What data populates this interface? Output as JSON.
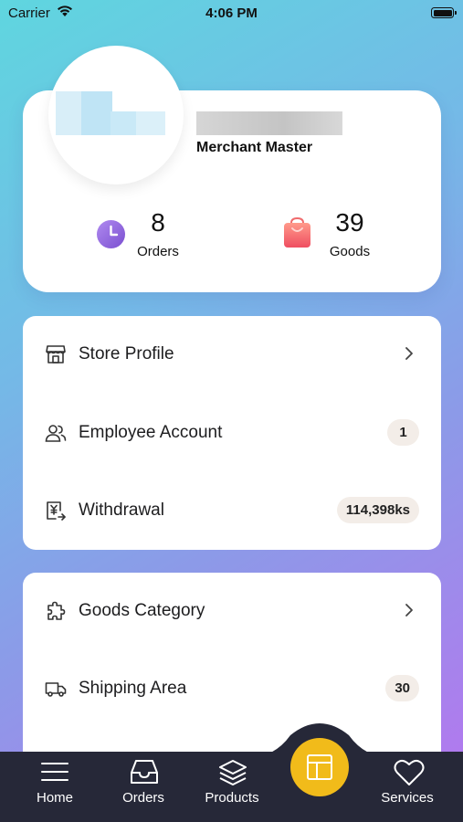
{
  "status_bar": {
    "carrier": "Carrier",
    "time": "4:06 PM"
  },
  "profile": {
    "merchant_title": "Merchant Master",
    "stats": [
      {
        "value": "8",
        "label": "Orders",
        "icon": "clock-icon",
        "color": "#8f6ad9"
      },
      {
        "value": "39",
        "label": "Goods",
        "icon": "shopping-bag-icon",
        "color": "#f06b6d"
      }
    ]
  },
  "menu_card_1": {
    "rows": [
      {
        "label": "Store Profile",
        "icon": "store-icon",
        "trailing": "chevron-right-icon"
      },
      {
        "label": "Employee Account",
        "icon": "users-icon",
        "badge": "1"
      },
      {
        "label": "Withdrawal",
        "icon": "yen-receipt-icon",
        "badge": "114,398ks"
      }
    ]
  },
  "menu_card_2": {
    "rows": [
      {
        "label": "Goods Category",
        "icon": "puzzle-icon",
        "trailing": "chevron-right-icon"
      },
      {
        "label": "Shipping Area",
        "icon": "truck-icon",
        "badge": "30"
      }
    ]
  },
  "bottom_nav": {
    "items": [
      {
        "label": "Home",
        "icon": "menu-icon"
      },
      {
        "label": "Orders",
        "icon": "inbox-icon"
      },
      {
        "label": "Products",
        "icon": "layers-icon"
      },
      {
        "label": "Services",
        "icon": "heart-icon"
      }
    ],
    "center_icon": "layout-icon",
    "center_color": "#f1bb1a",
    "background": "#262838"
  }
}
